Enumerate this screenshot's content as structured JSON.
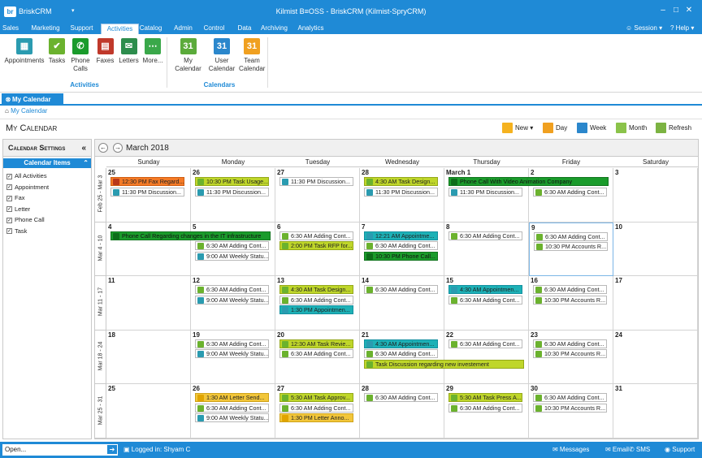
{
  "app": {
    "name": "BriskCRM",
    "window_title": "Kilmist B≡OSS - BriskCRM (Kilmist-SpryCRM)",
    "logo_text": "br"
  },
  "menu": {
    "items": [
      "Sales",
      "Marketing",
      "Support",
      "Activities",
      "Catalog",
      "Admin",
      "Control",
      "Data",
      "Archiving",
      "Analytics"
    ],
    "active": "Activities",
    "session": "Session",
    "help": "Help"
  },
  "ribbon": {
    "activities_buttons": [
      {
        "label": "Appointments",
        "icon": "appointments-icon",
        "color": "#2a9bb0"
      },
      {
        "label": "Tasks",
        "icon": "tasks-icon",
        "color": "#6bb22e"
      },
      {
        "label": "Phone\nCalls",
        "icon": "phone-icon",
        "color": "#1a9b2b"
      },
      {
        "label": "Faxes",
        "icon": "fax-icon",
        "color": "#c0392b"
      },
      {
        "label": "Letters",
        "icon": "letters-icon",
        "color": "#2d8d4d"
      },
      {
        "label": "More...",
        "icon": "more-icon",
        "color": "#3aa84a"
      }
    ],
    "activities_group": "Activities",
    "calendar_buttons": [
      {
        "label": "My Calendar",
        "icon": "my-calendar-icon",
        "color": "#5bab3b"
      },
      {
        "label": "User\nCalendar",
        "icon": "user-calendar-icon",
        "color": "#2b87cc"
      },
      {
        "label": "Team\nCalendar",
        "icon": "team-calendar-icon",
        "color": "#f0a020"
      }
    ],
    "calendar_group": "Calendars"
  },
  "tab": {
    "label": "My Calendar"
  },
  "breadcrumb": "My Calendar",
  "page_title": "My Calendar",
  "view_buttons": [
    {
      "label": "New",
      "icon": "new-icon",
      "color": "#f5b21f"
    },
    {
      "label": "Day",
      "icon": "day-icon",
      "color": "#f0a020"
    },
    {
      "label": "Week",
      "icon": "week-icon",
      "color": "#2b87cc"
    },
    {
      "label": "Month",
      "icon": "month-icon",
      "color": "#8bc34a"
    },
    {
      "label": "Refresh",
      "icon": "refresh-icon",
      "color": "#7cb342"
    }
  ],
  "settings": {
    "title": "Calendar Settings",
    "items_title": "Calendar Items",
    "items": [
      "All Activities",
      "Appointment",
      "Fax",
      "Letter",
      "Phone Call",
      "Task"
    ]
  },
  "calendar": {
    "month_label": "March 2018",
    "days": [
      "Sunday",
      "Monday",
      "Tuesday",
      "Wednesday",
      "Thursday",
      "Friday",
      "Saturday"
    ],
    "weeks": [
      {
        "label": "Feb 25 - Mar 3",
        "dates": [
          "25",
          "26",
          "27",
          "28",
          "March 1",
          "2",
          "3"
        ],
        "events": [
          [
            {
              "t": "12:30 PM Fax  Regard...",
              "k": "fax"
            },
            {
              "t": "11:30 PM Discussion...",
              "k": "appt"
            }
          ],
          [
            {
              "t": "10:30 PM Task  Usage...",
              "k": "task",
              "h": "y"
            },
            {
              "t": "11:30 PM Discussion...",
              "k": "appt"
            }
          ],
          [
            {
              "t": "11:30 PM Discussion...",
              "k": "appt"
            }
          ],
          [
            {
              "t": "4:30 AM Task  Design...",
              "k": "task",
              "h": "y"
            },
            {
              "t": "11:30 PM Discussion...",
              "k": "appt"
            }
          ],
          [
            {
              "t": "11:30 PM Discussion...",
              "k": "appt",
              "row": 1
            }
          ],
          [
            {
              "t": "6:30 AM Adding Cont...",
              "k": "task",
              "row": 1
            }
          ],
          []
        ],
        "spans": [
          {
            "t": "Phone Call  With Video Animation Company",
            "k": "call",
            "start": 4,
            "len": 2,
            "row": 0
          }
        ]
      },
      {
        "label": "Mar 4 - 10",
        "dates": [
          "4",
          "5",
          "6",
          "7",
          "8",
          "9",
          "10"
        ],
        "events": [
          [],
          [
            {
              "t": "6:30 AM Adding Cont...",
              "k": "task",
              "row": 1
            },
            {
              "t": "9:00 AM Weekly Statu...",
              "k": "appt",
              "row": 2
            }
          ],
          [
            {
              "t": "6:30 AM Adding Cont...",
              "k": "task"
            },
            {
              "t": "2:00 PM Task  RFP for...",
              "k": "task",
              "h": "y"
            }
          ],
          [
            {
              "t": "12:21 AM Appointme...",
              "k": "appt",
              "h": "t"
            },
            {
              "t": "6:30 AM Adding Cont...",
              "k": "task"
            },
            {
              "t": "10:30 PM Phone Call...",
              "k": "call"
            }
          ],
          [
            {
              "t": "6:30 AM Adding Cont...",
              "k": "task"
            }
          ],
          [
            {
              "t": "6:30 AM Adding Cont...",
              "k": "task"
            },
            {
              "t": "10:30 PM Accounts R...",
              "k": "task"
            }
          ],
          []
        ],
        "spans": [
          {
            "t": "Phone Call  Regarding changes in the IT infrastructure",
            "k": "call",
            "start": 0,
            "len": 2,
            "row": 0
          }
        ]
      },
      {
        "label": "Mar 11 - 17",
        "dates": [
          "11",
          "12",
          "13",
          "14",
          "15",
          "16",
          "17"
        ],
        "events": [
          [],
          [
            {
              "t": "6:30 AM Adding Cont...",
              "k": "task"
            },
            {
              "t": "9:00 AM Weekly Statu...",
              "k": "appt"
            }
          ],
          [
            {
              "t": "4:30 AM Task  Design...",
              "k": "task",
              "h": "y"
            },
            {
              "t": "6:30 AM Adding Cont...",
              "k": "task"
            },
            {
              "t": "1:30 PM Appointmen...",
              "k": "appt",
              "h": "t"
            }
          ],
          [
            {
              "t": "6:30 AM Adding Cont...",
              "k": "task"
            }
          ],
          [
            {
              "t": "4:30 AM Appointmen...",
              "k": "appt",
              "h": "t"
            },
            {
              "t": "6:30 AM Adding Cont...",
              "k": "task"
            }
          ],
          [
            {
              "t": "6:30 AM Adding Cont...",
              "k": "task"
            },
            {
              "t": "10:30 PM Accounts R...",
              "k": "task"
            }
          ],
          []
        ],
        "spans": []
      },
      {
        "label": "Mar 18 - 24",
        "dates": [
          "18",
          "19",
          "20",
          "21",
          "22",
          "23",
          "24"
        ],
        "events": [
          [],
          [
            {
              "t": "6:30 AM Adding Cont...",
              "k": "task"
            },
            {
              "t": "9:00 AM Weekly Statu...",
              "k": "appt"
            }
          ],
          [
            {
              "t": "12:30 AM Task  Revie...",
              "k": "task",
              "h": "y"
            },
            {
              "t": "6:30 AM Adding Cont...",
              "k": "task"
            }
          ],
          [
            {
              "t": "4:30 AM Appointmen...",
              "k": "appt",
              "h": "t"
            },
            {
              "t": "6:30 AM Adding Cont...",
              "k": "task"
            }
          ],
          [
            {
              "t": "6:30 AM Adding Cont...",
              "k": "task"
            }
          ],
          [
            {
              "t": "6:30 AM Adding Cont...",
              "k": "task"
            },
            {
              "t": "10:30 PM Accounts R...",
              "k": "task"
            }
          ],
          []
        ],
        "spans": [
          {
            "t": "Task  Discussion regarding new investement",
            "k": "task",
            "h": "y",
            "start": 3,
            "len": 2,
            "row": 2
          }
        ]
      },
      {
        "label": "Mar 25 - 31",
        "dates": [
          "25",
          "26",
          "27",
          "28",
          "29",
          "30",
          "31"
        ],
        "events": [
          [],
          [
            {
              "t": "1:30 AM Letter  Send...",
              "k": "letter",
              "h": "o"
            },
            {
              "t": "6:30 AM Adding Cont...",
              "k": "task"
            },
            {
              "t": "9:00 AM Weekly Statu...",
              "k": "appt"
            }
          ],
          [
            {
              "t": "5:30 AM Task  Approv...",
              "k": "task",
              "h": "y"
            },
            {
              "t": "6:30 AM Adding Cont...",
              "k": "task"
            },
            {
              "t": "1:30 PM Letter  Anno...",
              "k": "letter",
              "h": "o"
            }
          ],
          [
            {
              "t": "6:30 AM Adding Cont...",
              "k": "task"
            }
          ],
          [
            {
              "t": "5:30 AM Task  Press A...",
              "k": "task",
              "h": "y"
            },
            {
              "t": "6:30 AM Adding Cont...",
              "k": "task"
            }
          ],
          [
            {
              "t": "6:30 AM Adding Cont...",
              "k": "task"
            },
            {
              "t": "10:30 PM Accounts R...",
              "k": "task"
            }
          ],
          []
        ],
        "spans": []
      }
    ]
  },
  "status": {
    "open_placeholder": "Open...",
    "logged_in": "Logged in:  Shyam C",
    "right_items": [
      "Messages",
      "Email",
      "SMS",
      "Support"
    ]
  }
}
